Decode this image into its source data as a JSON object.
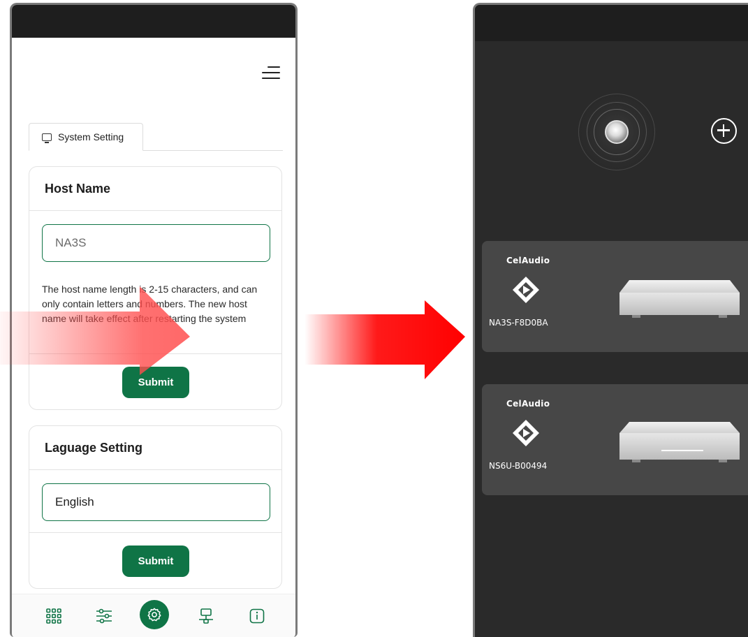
{
  "left_app": {
    "tab": {
      "label": "System Setting",
      "icon": "monitor-icon"
    },
    "host_name_card": {
      "title": "Host Name",
      "input_value": "NA3S",
      "help_text": "The host name length is 2-15 characters, and can only contain letters and numbers. The new host name will take effect after restarting the system",
      "submit_label": "Submit"
    },
    "language_card": {
      "title": "Laguage Setting",
      "selected_value": "English",
      "submit_label": "Submit"
    },
    "bottom_nav": [
      "grid-icon",
      "sliders-icon",
      "settings-gear-icon",
      "network-icon",
      "info-icon"
    ],
    "accent_color": "#0f7446"
  },
  "right_app": {
    "devices": [
      {
        "brand": "CelAudio",
        "name": "NA3S-F8D0BA"
      },
      {
        "brand": "CelAudio",
        "name": "NS6U-B00494"
      }
    ],
    "background_color": "#2a2a2a",
    "card_color": "#474747"
  },
  "arrow_color": "#ff0000"
}
